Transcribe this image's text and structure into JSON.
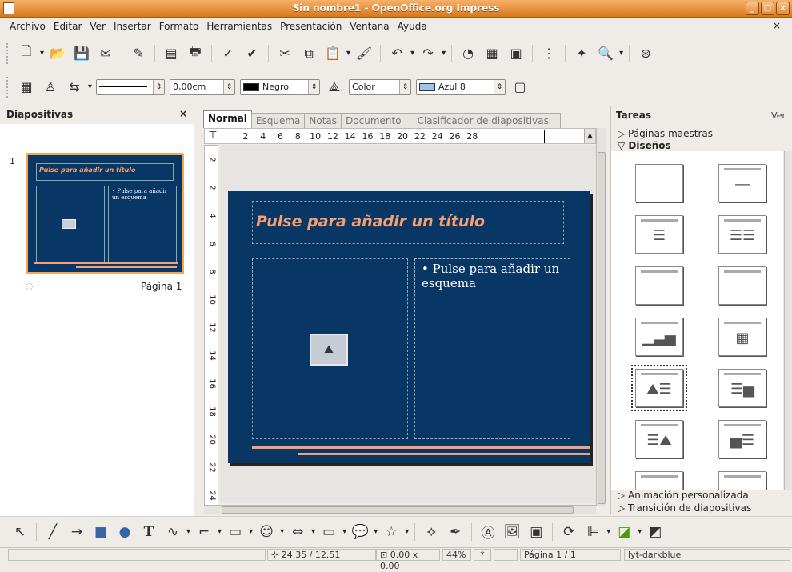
{
  "window": {
    "title": "Sin nombre1 - OpenOffice.org Impress"
  },
  "menu": [
    "Archivo",
    "Editar",
    "Ver",
    "Insertar",
    "Formato",
    "Herramientas",
    "Presentación",
    "Ventana",
    "Ayuda"
  ],
  "menu_close": "×",
  "toolbar2": {
    "line_width": "0,00cm",
    "line_color": "Negro",
    "area_style": "Color",
    "area_color": "Azul 8"
  },
  "slides_panel": {
    "title": "Diapositivas",
    "close": "×",
    "slide_number": "1",
    "page_label": "Página 1"
  },
  "slide": {
    "title_placeholder": "Pulse para añadir un título",
    "outline_placeholder": "• Pulse para añadir un esquema",
    "thumb_title": "Pulse para añadir un título",
    "thumb_outline": "• Pulse para añadir un esquema"
  },
  "view_tabs": [
    "Normal",
    "Esquema",
    "Notas",
    "Documento",
    "Clasificador de diapositivas"
  ],
  "active_tab": "Normal",
  "ruler": {
    "h_ticks": [
      "2",
      "4",
      "6",
      "8",
      "10",
      "12",
      "14",
      "16",
      "18",
      "20",
      "22",
      "24",
      "26",
      "28"
    ],
    "v_ticks": [
      "2",
      "2",
      "4",
      "6",
      "8",
      "10",
      "12",
      "14",
      "16",
      "18",
      "20",
      "22",
      "24"
    ]
  },
  "tasks_panel": {
    "title": "Tareas",
    "view_label": "Ver",
    "master_pages": "▷ Páginas maestras",
    "layouts": "▽ Diseños",
    "custom_animation": "▷ Animación personalizada",
    "slide_transition": "▷ Transición de diapositivas"
  },
  "status": {
    "position": "24.35 / 12.51",
    "size": "0.00 x 0.00",
    "zoom": "44%",
    "modified": "*",
    "page": "Página 1 / 1",
    "master": "lyt-darkblue"
  },
  "accent_colors": {
    "titlebar": "#e08a30",
    "slide_bg": "#083665",
    "slide_accent": "#f5a07a"
  }
}
